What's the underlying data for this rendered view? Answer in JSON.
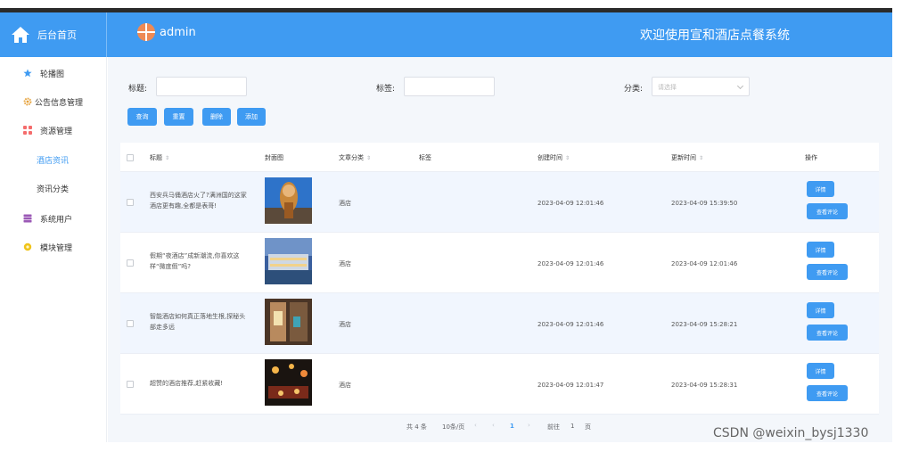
{
  "header": {
    "home_label": "后台首页",
    "user_name": "admin",
    "site_title": "欢迎使用宣和酒店点餐系统",
    "colors": {
      "primary": "#3f9bf2"
    }
  },
  "sidebar": {
    "items": [
      {
        "label": "轮播图",
        "icon": "star-icon"
      },
      {
        "label": "公告信息管理",
        "icon": "gear-icon"
      },
      {
        "label": "资源管理",
        "icon": "grid-icon"
      },
      {
        "label": "系统用户",
        "icon": "database-icon"
      },
      {
        "label": "模块管理",
        "icon": "flower-icon"
      }
    ],
    "sub_items": [
      {
        "label": "酒店资讯",
        "active": true
      },
      {
        "label": "资讯分类",
        "active": false
      }
    ]
  },
  "filters": {
    "title_label": "标题:",
    "tag_label": "标签:",
    "category_label": "分类:",
    "category_placeholder": "请选择"
  },
  "actions": {
    "search": "查询",
    "reset": "重置",
    "delete": "删除",
    "add": "添加"
  },
  "table": {
    "headers": {
      "title": "标题",
      "cover": "封面图",
      "category": "文章分类",
      "tags": "标签",
      "created": "创建时间",
      "updated": "更新时间",
      "ops": "操作"
    },
    "rows": [
      {
        "title_line1": "西安兵马俑酒店火了?满洲国的这家",
        "title_line2": "酒店更有趣,全都是表哥!",
        "category": "酒店",
        "created": "2023-04-09 12:01:46",
        "updated": "2023-04-09 15:39:50"
      },
      {
        "title_line1": "假期“夜酒店”成新潮流,你喜欢这",
        "title_line2": "样“微度假”吗?",
        "category": "酒店",
        "created": "2023-04-09 12:01:46",
        "updated": "2023-04-09 12:01:46"
      },
      {
        "title_line1": "智能酒店如何真正落地生根,探秘头",
        "title_line2": "部走多远",
        "category": "酒店",
        "created": "2023-04-09 12:01:46",
        "updated": "2023-04-09 15:28:21"
      },
      {
        "title_line1": "超赞的酒店推荐,赶紧收藏!",
        "title_line2": "",
        "category": "酒店",
        "created": "2023-04-09 12:01:47",
        "updated": "2023-04-09 15:28:31"
      }
    ],
    "row_actions": {
      "detail": "详情",
      "comments": "查看评论"
    }
  },
  "pagination": {
    "total": "共 4 条",
    "page_size": "10条/页",
    "prev": "‹",
    "current_page": "1",
    "next": "›",
    "goto_label": "前往",
    "goto_value": "1",
    "page_suffix": "页"
  },
  "watermark": "CSDN @weixin_bysj1330"
}
